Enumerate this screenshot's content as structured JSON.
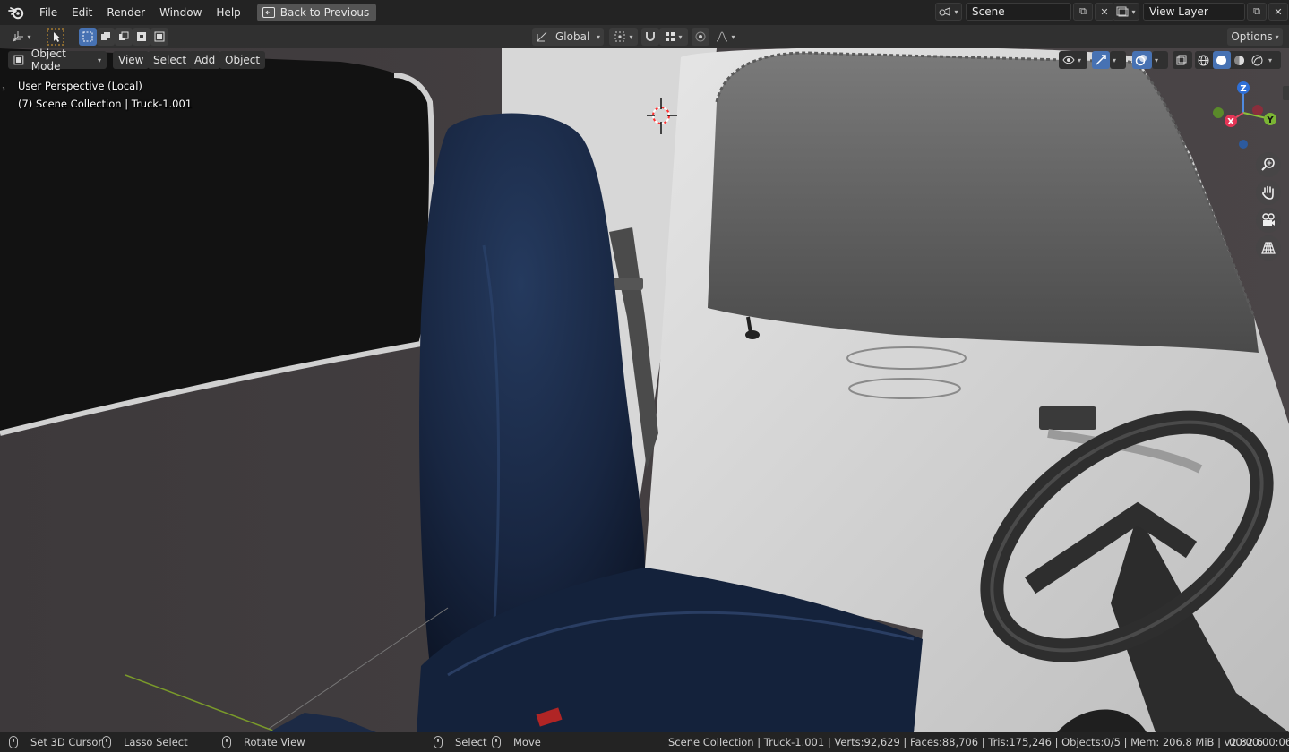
{
  "topbar": {
    "menus": [
      "File",
      "Edit",
      "Render",
      "Window",
      "Help"
    ],
    "back_button": "Back to Previous",
    "scene_name": "Scene",
    "view_layer_name": "View Layer"
  },
  "toolheader": {
    "transform_orientation": "Global",
    "options_label": "Options"
  },
  "viewport_header": {
    "mode": "Object Mode",
    "menus": [
      "View",
      "Select",
      "Add",
      "Object"
    ]
  },
  "overlay": {
    "perspective": "User Perspective (Local)",
    "collection_info": "(7) Scene Collection | Truck-1.001"
  },
  "gizmo": {
    "z": "Z",
    "y": "Y",
    "x": "X"
  },
  "statusbar": {
    "set_cursor": "Set 3D Cursor",
    "lasso": "Lasso Select",
    "rotate": "Rotate View",
    "select": "Select",
    "move": "Move",
    "stats": "Scene Collection | Truck-1.001 | Verts:92,629 | Faces:88,706 | Tris:175,246 | Objects:0/5 | Mem: 206.8 MiB | v2.82.6",
    "time": "00:00:00:06"
  },
  "colors": {
    "accent": "#4772b3",
    "seat": "#1b2a45",
    "door": "#c9c9c9"
  }
}
